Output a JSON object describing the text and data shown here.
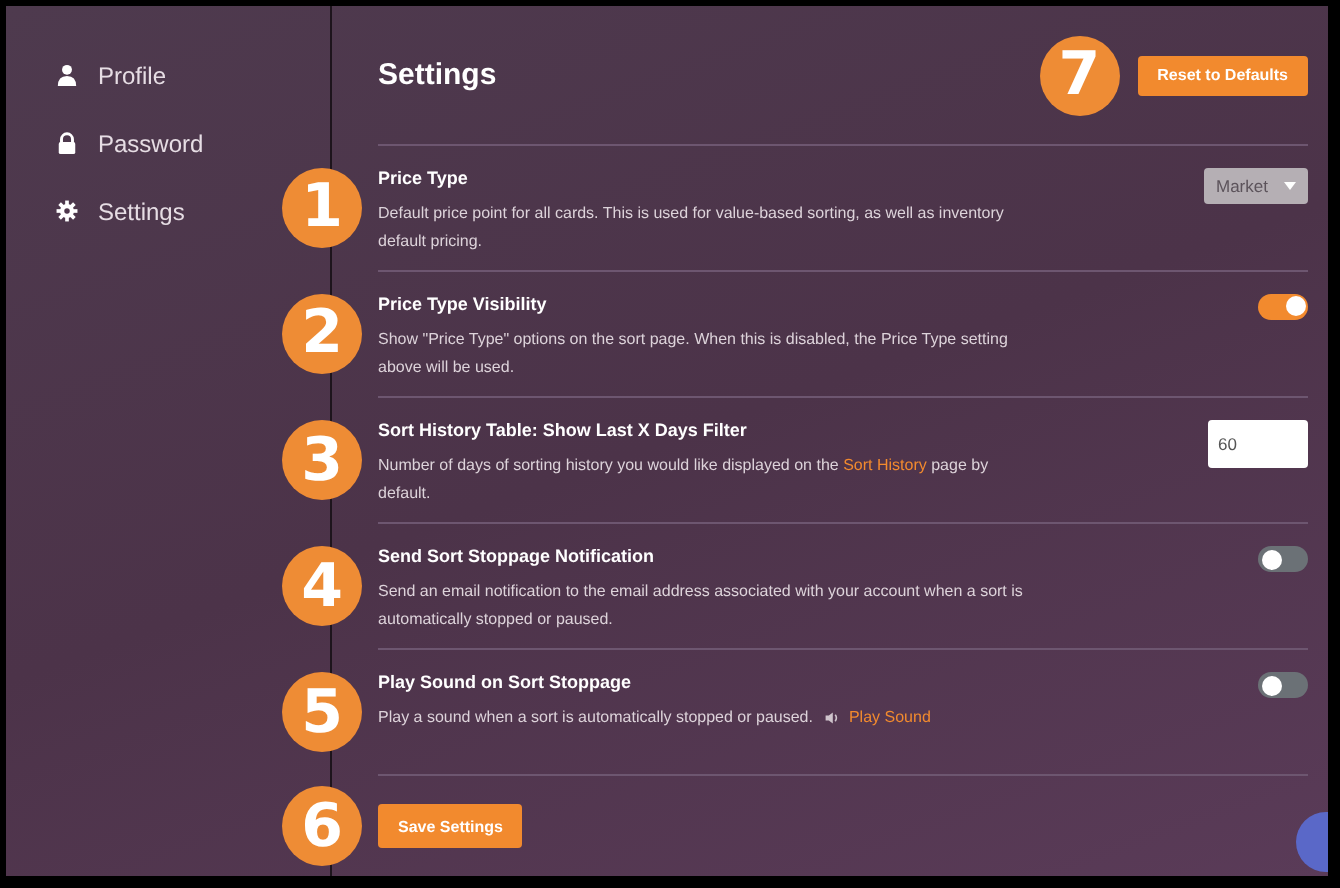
{
  "sidebar": {
    "items": [
      {
        "label": "Profile"
      },
      {
        "label": "Password"
      },
      {
        "label": "Settings"
      }
    ]
  },
  "header": {
    "title": "Settings",
    "reset_button": {
      "label": "Reset to Defaults",
      "marker": "7"
    }
  },
  "settings": [
    {
      "kind": "select",
      "marker": "1",
      "title": "Price Type",
      "description": "Default price point for all cards. This is used for value-based sorting, as well as inventory default pricing.",
      "value": "Market"
    },
    {
      "kind": "toggle",
      "marker": "2",
      "title": "Price Type Visibility",
      "description": "Show \"Price Type\" options on the sort page. When this is disabled, the Price Type setting above will be used.",
      "on": true
    },
    {
      "kind": "number",
      "marker": "3",
      "title": "Sort History Table: Show Last X Days Filter",
      "description": "Number of days of sorting history you would like displayed on the",
      "link": "Sort History",
      "description_after": "page by default.",
      "value": "60"
    },
    {
      "kind": "toggle",
      "marker": "4",
      "title": "Send Sort Stoppage Notification",
      "description": "Send an email notification to the email address associated with your account when a sort is automatically stopped or paused.",
      "on": false
    },
    {
      "kind": "toggle",
      "marker": "5",
      "title": "Play Sound on Sort Stoppage",
      "description": "Play a sound when a sort is automatically stopped or paused.",
      "action": "Play Sound",
      "on": false
    }
  ],
  "save_button": {
    "label": "Save Settings",
    "marker": "6"
  }
}
